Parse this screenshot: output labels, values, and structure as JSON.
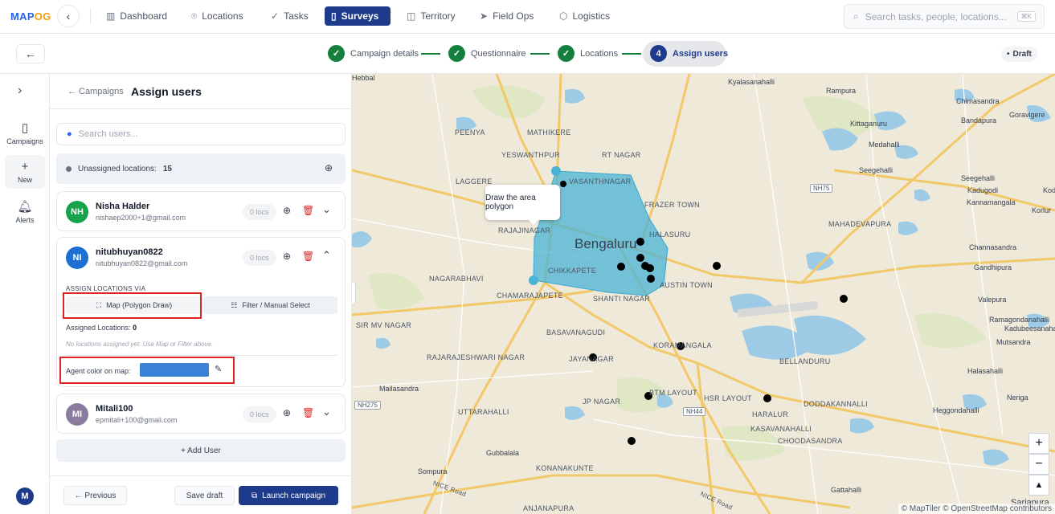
{
  "brand": {
    "logo_text": "MAP",
    "logo_accent": "OG"
  },
  "nav": {
    "items": [
      {
        "label": "Dashboard",
        "icon": "chart-icon",
        "active": false
      },
      {
        "label": "Locations",
        "icon": "pin-icon",
        "active": false
      },
      {
        "label": "Tasks",
        "icon": "check-icon",
        "active": false
      },
      {
        "label": "Surveys",
        "icon": "clipboard-icon",
        "active": true
      },
      {
        "label": "Territory",
        "icon": "map-icon",
        "active": false
      },
      {
        "label": "Field Ops",
        "icon": "send-icon",
        "active": false
      },
      {
        "label": "Logistics",
        "icon": "box-icon",
        "active": false
      }
    ],
    "search_placeholder": "Search tasks, people, locations...",
    "search_shortcut": "⌘K"
  },
  "stepper": {
    "steps": [
      {
        "num": "1",
        "label": "Campaign details",
        "status": "done"
      },
      {
        "num": "2",
        "label": "Questionnaire",
        "status": "done"
      },
      {
        "num": "3",
        "label": "Locations",
        "status": "done"
      },
      {
        "num": "4",
        "label": "Assign users",
        "status": "current"
      }
    ],
    "status_badge": "Draft"
  },
  "rail": {
    "items": [
      {
        "label": "Campaigns",
        "icon": "clipboard-icon"
      },
      {
        "label": "New",
        "icon": "plus-icon"
      },
      {
        "label": "Alerts",
        "icon": "bell-icon"
      }
    ],
    "user_initial": "M"
  },
  "panel": {
    "breadcrumb": "← Campaigns",
    "title": "Assign users",
    "search_placeholder": "Search users...",
    "unassigned_label": "Unassigned locations:",
    "unassigned_count": "15",
    "users": [
      {
        "initials": "NH",
        "name": "Nisha Halder",
        "email": "nishaep2000+1@gmail.com",
        "locs": "0 locs",
        "avatar_color": "#16a34a",
        "expanded": false
      },
      {
        "initials": "NI",
        "name": "nitubhuyan0822",
        "email": "nitubhuyan0822@gmail.com",
        "locs": "0 locs",
        "avatar_color": "#1d6fd1",
        "expanded": true
      },
      {
        "initials": "MI",
        "name": "Mitali100",
        "email": "epmitali+100@gmail.com",
        "locs": "0 locs",
        "avatar_color": "#8b7b9e",
        "expanded": false
      }
    ],
    "assign_via_label": "ASSIGN LOCATIONS VIA",
    "map_button": "Map (Polygon Draw)",
    "filter_button": "Filter / Manual Select",
    "assigned_label": "Assigned Locations:",
    "assigned_count": "0",
    "no_locations_text": "No locations assigned yet. Use Map or Filter above.",
    "agent_color_label": "Agent color on map:",
    "agent_color": "#3b82d6",
    "add_user": "+ Add User",
    "previous": "← Previous",
    "save_draft": "Save draft",
    "launch": "Launch campaign"
  },
  "map": {
    "tooltip": "Draw the area polygon",
    "city": "Bengaluru",
    "place_labels": [
      "Hebbal",
      "Kyalasanahalli",
      "Rampura",
      "Chimasandra",
      "PEENYA",
      "MATHIKERE",
      "Kittaganuru",
      "Bandapura",
      "Goravigere",
      "YESWANTHPUR",
      "RT NAGAR",
      "Medahalli",
      "Seegehalli",
      "Seegehalli",
      "LAGGERE",
      "VASANTHNAGAR",
      "FRAZER TOWN",
      "Kadugodi",
      "Kannamangala",
      "Kodi",
      "MAHADEVAPURA",
      "RAJAJINAGAR",
      "Korlur",
      "HALASURU",
      "Channasandra",
      "CHIKKAPETE",
      "Gandhipura",
      "NAGARABHAVI",
      "CHAMARAJAPETE",
      "SHANTI NAGAR",
      "AUSTIN TOWN",
      "Valepura",
      "Ramagondanahalli",
      "SIR MV NAGAR",
      "BASAVANAGUDI",
      "Kadubeesanahalli",
      "RAJARAJESHWARI NAGAR",
      "JAYANAGAR",
      "KORAMANGALA",
      "BELLANDURU",
      "Mutsandra",
      "Halasahalli",
      "Mailasandra",
      "BTM LAYOUT",
      "HSR LAYOUT",
      "JP NAGAR",
      "Neriga",
      "UTTARAHALLI",
      "DODDAKANNALLI",
      "HARALUR",
      "Heggondahalli",
      "Gubbalala",
      "KONANAKUNTE",
      "KASAVANAHALLI",
      "CHOODASANDRA",
      "Sompura",
      "Gattahalli",
      "ANJANAPURA",
      "Sarjapura"
    ],
    "road_signs": [
      "NH75",
      "NH275",
      "NH44",
      "NICE Road",
      "NICE Road"
    ],
    "attribution": "© MapTiler © OpenStreetMap contributors",
    "zoom_in": "+",
    "zoom_out": "−",
    "compass": "▲"
  }
}
